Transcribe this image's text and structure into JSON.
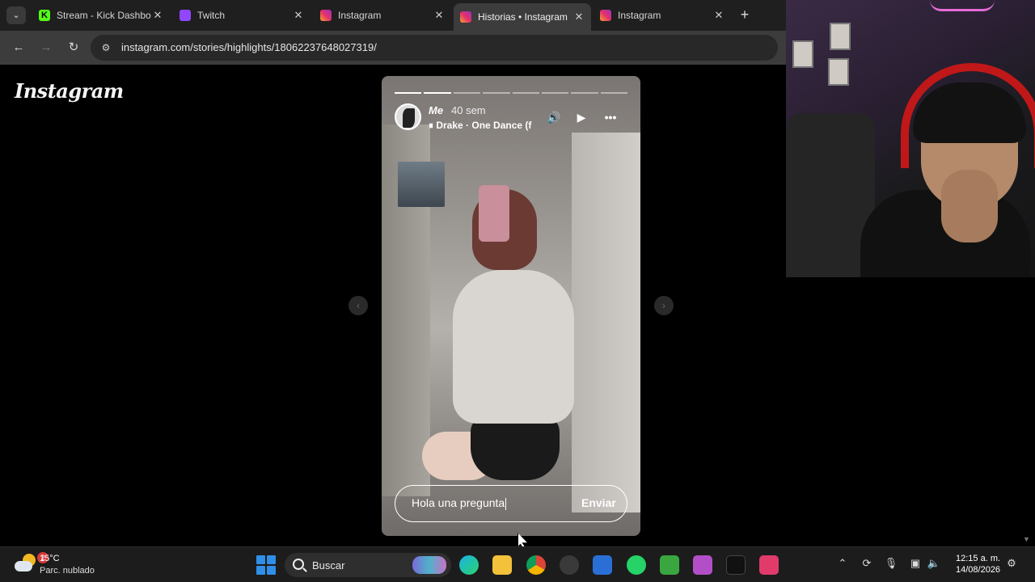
{
  "browser": {
    "tabs": [
      {
        "title": "Stream - Kick Dashbo",
        "icon": "kick-icon"
      },
      {
        "title": "Twitch",
        "icon": "twitch-icon"
      },
      {
        "title": "Instagram",
        "icon": "instagram-icon"
      },
      {
        "title": "Historias • Instagram",
        "icon": "instagram-icon",
        "active": true
      },
      {
        "title": "Instagram",
        "icon": "instagram-icon"
      }
    ],
    "close_glyph": "✕",
    "new_tab_glyph": "+",
    "url": "instagram.com/stories/highlights/18062237648027319/"
  },
  "instagram": {
    "logo": "Instagram",
    "story": {
      "segments_total": 8,
      "segments_done": 2,
      "username": "Me",
      "time": "40 sem",
      "music": "Drake · One Dance (f",
      "reply_value": "Hola una pregunta",
      "send_label": "Enviar"
    }
  },
  "taskbar": {
    "temperature": "15°C",
    "condition": "Parc. nublado",
    "weather_badge": "2",
    "search_label": "Buscar",
    "time": "12:15 a. m.",
    "date": "14/08/2026"
  },
  "colors": {
    "browser_frame": "#1f1f1f",
    "toolbar": "#3c3c3c",
    "kick_green": "#53fc18",
    "twitch_purple": "#9146ff",
    "headset_red": "#c01818"
  }
}
